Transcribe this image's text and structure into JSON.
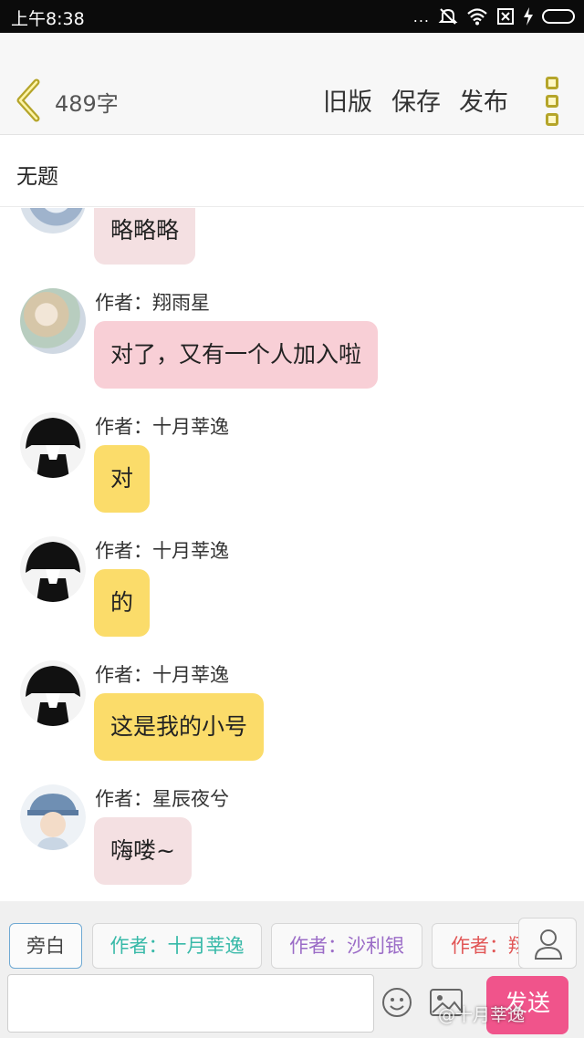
{
  "status_bar": {
    "time": "上午8:38",
    "dots": "...",
    "icons": [
      "mute-icon",
      "wifi-icon",
      "sim-off-icon",
      "charging-icon",
      "battery-icon"
    ]
  },
  "toolbar": {
    "back_icon": "back-chevron-icon",
    "word_count": "489字",
    "old_version_label": "旧版",
    "save_label": "保存",
    "publish_label": "发布",
    "more_icon": "more-menu-icon",
    "accent_color": "#b5a52a"
  },
  "title": "无题",
  "messages": [
    {
      "avatar": "avatar-girl-icon",
      "author": "",
      "text": "略略略",
      "bubble_color": "#f4e0e2"
    },
    {
      "avatar": "avatar-flowers-icon",
      "author": "作者：翔雨星",
      "text": "对了，又有一个人加入啦",
      "bubble_color": "#f8cfd6"
    },
    {
      "avatar": "avatar-boy-cap-icon",
      "author": "作者：十月莘逸",
      "text": "对",
      "bubble_color": "#fbdc6a"
    },
    {
      "avatar": "avatar-boy-cap-icon",
      "author": "作者：十月莘逸",
      "text": "的",
      "bubble_color": "#fbdc6a"
    },
    {
      "avatar": "avatar-boy-cap-icon",
      "author": "作者：十月莘逸",
      "text": "这是我的小号",
      "bubble_color": "#fbdc6a"
    },
    {
      "avatar": "avatar-girl-icon",
      "author": "作者：星辰夜兮",
      "text": "嗨喽~",
      "bubble_color": "#f4e0e2"
    }
  ],
  "roles": {
    "narrator": "旁白",
    "author1": "作者：十月莘逸",
    "author2": "作者：沙利银",
    "author3": "作者：翔"
  },
  "input": {
    "value": "",
    "emoji_icon": "emoji-icon",
    "image_icon": "image-icon",
    "send_label": "发送",
    "send_color": "#f0548b"
  },
  "watermark": "@十月莘逸"
}
